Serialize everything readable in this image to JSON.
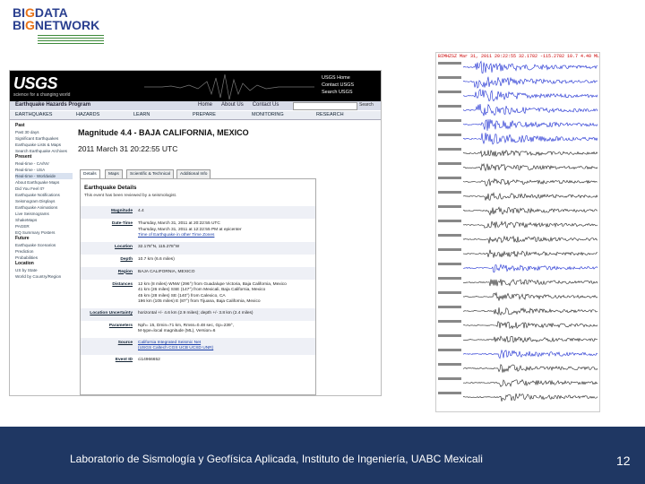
{
  "logo": {
    "line1_a": "BI",
    "line1_b": "G",
    "line1_c": "DATA",
    "line2_a": "BI",
    "line2_b": "G",
    "line2_c": "NETWORK"
  },
  "usgs": {
    "logo": "USGS",
    "tagline": "science for a changing world",
    "links": [
      "USGS Home",
      "Contact USGS",
      "Search USGS"
    ],
    "program": "Earthquake Hazards Program",
    "toplinks": [
      "Home",
      "About Us",
      "Contact Us"
    ],
    "search_button": "Search",
    "nav": [
      "EARTHQUAKES",
      "HAZARDS",
      "LEARN",
      "PREPARE",
      "MONITORING",
      "RESEARCH"
    ]
  },
  "sidebar": [
    {
      "label": "Past",
      "type": "h"
    },
    {
      "label": "Past 30 days",
      "type": "i"
    },
    {
      "label": "Significant Earthquakes",
      "type": "i"
    },
    {
      "label": "Earthquake Lists & Maps",
      "type": "i"
    },
    {
      "label": "Search Earthquake Archives",
      "type": "i"
    },
    {
      "label": "Present",
      "type": "h"
    },
    {
      "label": "Real-time - CA/NV",
      "type": "i"
    },
    {
      "label": "Real-time - USA",
      "type": "i"
    },
    {
      "label": "Real-time - Worldwide",
      "type": "sel"
    },
    {
      "label": "About Earthquake Maps",
      "type": "i"
    },
    {
      "label": "Did You Feel It?",
      "type": "i"
    },
    {
      "label": "Earthquake Notifications",
      "type": "i"
    },
    {
      "label": "Seismogram Displays",
      "type": "i"
    },
    {
      "label": "Earthquake Animations",
      "type": "i"
    },
    {
      "label": "Live Seismograms",
      "type": "i"
    },
    {
      "label": "ShakeMaps",
      "type": "i"
    },
    {
      "label": "PAGER",
      "type": "i"
    },
    {
      "label": "EQ Summary Posters",
      "type": "i"
    },
    {
      "label": "Future",
      "type": "h"
    },
    {
      "label": "Earthquake Scenarios",
      "type": "i"
    },
    {
      "label": "Prediction",
      "type": "i"
    },
    {
      "label": "Probabilities",
      "type": "i"
    },
    {
      "label": "Location",
      "type": "h"
    },
    {
      "label": "US by State",
      "type": "i"
    },
    {
      "label": "World by Country/Region",
      "type": "i"
    }
  ],
  "event": {
    "title": "Magnitude 4.4 - BAJA CALIFORNIA, MEXICO",
    "datetime": "2011 March 31 20:22:55 UTC",
    "tabs": [
      "Details",
      "Maps",
      "Scientific & Technical",
      "Additional Info"
    ],
    "details_heading": "Earthquake Details",
    "review_note": "This event has been reviewed by a seismologist.",
    "rows": [
      {
        "label": "Magnitude",
        "lines": [
          "4.4"
        ]
      },
      {
        "label": "Date-Time",
        "lines": [
          "Thursday, March 31, 2011 at 20:22:55 UTC",
          "Thursday, March 31, 2011 at 12:22:55 PM at epicenter",
          "Time of Earthquake in other Time Zones"
        ]
      },
      {
        "label": "Location",
        "lines": [
          "32.178°N, 115.278°W"
        ]
      },
      {
        "label": "Depth",
        "lines": [
          "10.7 km (6.6 miles)"
        ]
      },
      {
        "label": "Region",
        "lines": [
          "BAJA CALIFORNIA, MEXICO"
        ]
      },
      {
        "label": "Distances",
        "lines": [
          "12 km (8 miles) WNW (296°) from Guadalupe Victoria, Baja California, Mexico",
          "41 km (26 miles) SSE (147°) from Mexicali, Baja California, Mexico",
          "45 km (28 miles) SE (140°) from Calexico, CA",
          "196 km (105 miles) E (87°) from Tijuana, Baja California, Mexico"
        ]
      },
      {
        "label": "Location Uncertainty",
        "lines": [
          "horizontal +/- 4.6 km (2.9 miles); depth +/- 3.8 km (2.4 miles)"
        ]
      },
      {
        "label": "Parameters",
        "lines": [
          "Nph= 15, Dmin=71 km, Rmss=0.48 sec, Gp=239°,",
          "M-type=local magnitude (ML), Version=6"
        ]
      },
      {
        "label": "Source",
        "lines": [
          "California Integrated Seismic Net",
          "(USGS Caltech CGS UCB UCSD UNR)"
        ]
      },
      {
        "label": "Event ID",
        "lines": [
          "ci14966652"
        ]
      }
    ]
  },
  "seismogram": {
    "header": "BIMHZSZ Mar 31, 2011 20:22:55 32.1782 -115.2782 10.7 4.40 ML"
  },
  "footer": {
    "text": "Laboratorio de Sismología y Geofísica Aplicada, Instituto de Ingeniería, UABC Mexicali",
    "page_number": "12"
  }
}
